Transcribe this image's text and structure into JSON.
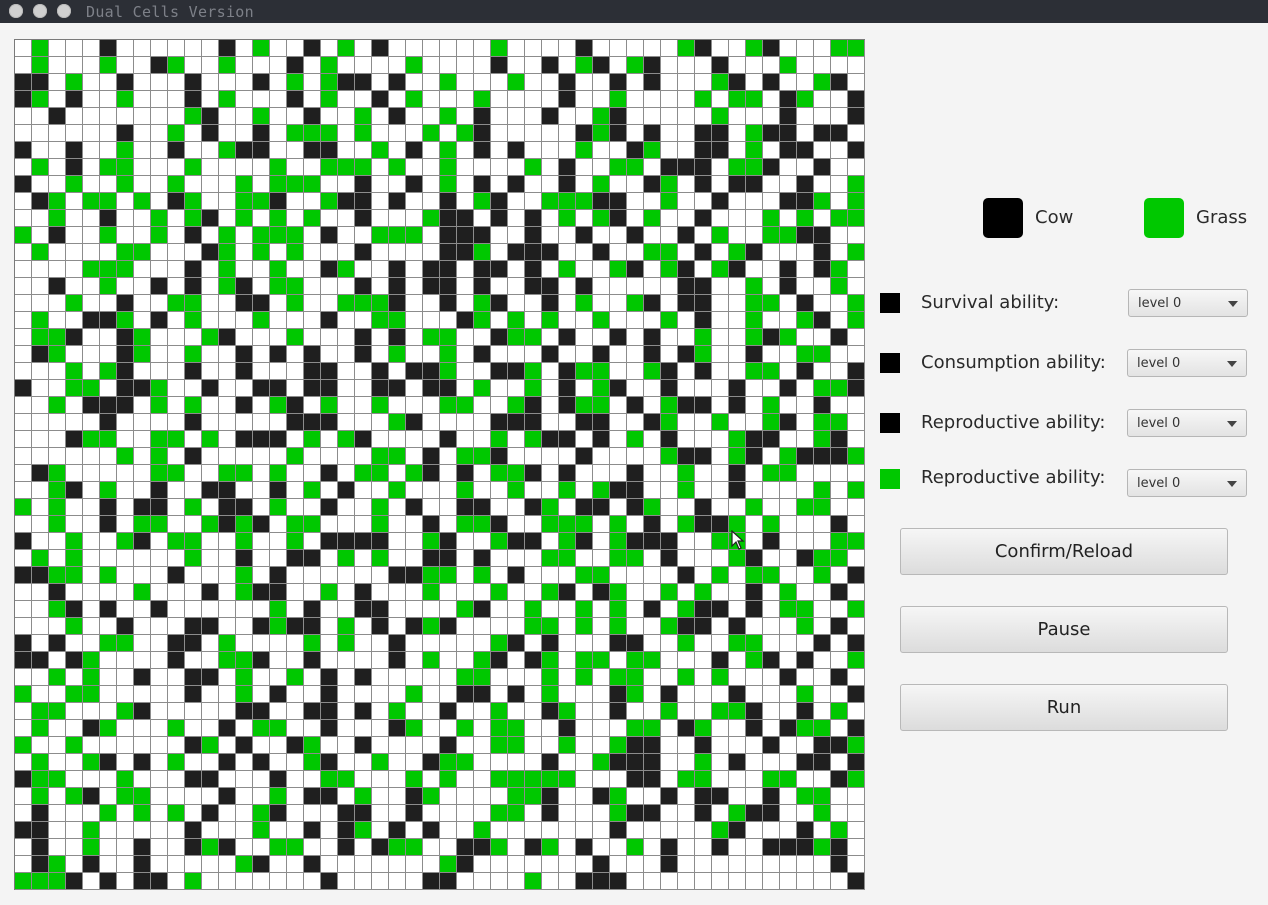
{
  "window": {
    "title": "Dual Cells Version"
  },
  "colors": {
    "cow": "#1f1f1f",
    "grass": "#00c800",
    "empty": "#ffffff",
    "grid_line": "#8c8c8c"
  },
  "legend": {
    "cow_label": "Cow",
    "grass_label": "Grass"
  },
  "controls": {
    "rows": [
      {
        "label": "Survival ability:",
        "swatch": "cow",
        "value": "level 0"
      },
      {
        "label": "Consumption ability:",
        "swatch": "cow",
        "value": "level 0"
      },
      {
        "label": "Reproductive ability:",
        "swatch": "cow",
        "value": "level 0"
      },
      {
        "label": "Reproductive ability:",
        "swatch": "grass",
        "value": "level 0"
      }
    ]
  },
  "buttons": {
    "confirm": "Confirm/Reload",
    "pause": "Pause",
    "run": "Run"
  },
  "grid": {
    "size": 50,
    "rows": [
      ".G...C......C.G..C.G.C......G....C.....GC..GC...GGG",
      ".G...G..CG..G...C.G....G....C..C.GC.GC...C...G....",
      "CC.G..C...C...C.G.GCC.C..G...G..C..C.C...GC.C..GC.",
      "CG.C..G...C.G...C.G..C.G...G....C..G....G.GG.CG..C",
      "..C.......GC..G..C..G.C..G.C...C..GC.....G...C...C",
      "......C..G.C..C.GGG.G...G.GC.....CGC.C..CC.GCC.CC.",
      "C..C..G..C..GCC..CC..G.C.G.C.C...G..CG..CC.G.CC..C",
      ".G.C.GG...G....G..GGG.G..G....G.C..GG.CCC.GGC..C..",
      "C..G..G..G...G.GGG..C..C.G.C.C..C.G..CG.C.CC..C..G",
      ".CG.GG.G.CG..GGC..GCC.C..C.GC..GGGCC..G..C...CCG.G",
      "..G..C..G.GC.G.G.G..C...GCC.C.C.G.GC.G..C...G.G.GG",
      "G.C..G..G.C.G.GGG.C..GGG.CCC..C..C..C..C.G..GGCC..",
      ".G....GG...CG.G.G...C....CCG.CCC..C..GG.C.GC...C.G",
      "....GGG...C.G..G..CG..C.CC.CC.C.G..GC.GC.GC..C.CG.",
      "..C..G..C.C.GC.GG...C.C.CC.C..CC.C.....CC..G.C..G.",
      "...G..C..GG..CC.G..GGGC..C.GC..C.G..GC.CC..GG.C..GG",
      ".G..CCG.C.G...G...C..GG...CG.G.G..G...G.C..G..GC.G",
      ".GGC..CG...GC...G...C.C.GG..CGG.C..C.C..G..GCG..C.",
      ".CG...CG..G..C.C.C..C.G..G.C...C..C..C.CG..C..GG..",
      "...G.GC...C..C...CC..C.CCG..CCG.CGG..GC.C..GG.C..C",
      "C..GG.CCG..C..CC.CC..CC.CC.G..G.C.GC..C...C..C.GGC",
      "..G.CCC.G.G..C.GC.G..G...GG..GC.CGG.C.GCC.C.G..C..",
      ".....C....C.....CCC...GC....CCC..CC..CG..G..GC.GG.",
      "...CGG..GG.G.CCC.G.GC....C..G.GCC.C.G.C...GCC..GC.",
      "......G.G.C.....G....GG.C.GGC....C....GCC.GC.GCCCG.",
      ".CG.....GG..GG.G..C.GG.GC.C.GGC.C...C..G..C.GG....G",
      "..GC.G..C..CC..C.G.C..G...G..G..G.GCC..G..C....G.G.",
      "G.G..C.CC.G.CC.G..C..G.C..CC..CG.CC.CG..C..G..GG..C",
      "..G..C.GG..GCGC.GG...G..C.GGC..GGG.G.C.GCCG.G...C.",
      "C..G..GC.GG..G..G.CCCC..GC..GCC.GC.GCCC..GG.C...GG",
      ".G.G......G..C..CC.G.G..CC.C...GG..GG.C...GC..CGG.",
      "CCGG.G...C...G.C......CCGG.G.C...GG....C.G.GG..G.C",
      "..C....G...C.GCC..G.C...G...G..GC.CG..G.G..C.G..C.",
      "..GC.C..C......G.C..CC....GC..G..G.G.C.GCC.C.GG..G",
      "...G..C...CC..CGCC.G.C.CGC....GG.G.G..GCC.C...G.C.",
      "C.C..GG..CC.G....G.G..C.....GC.C...CC..G..GG...C.C",
      "CC.CG....C..GGC..C....C.G..GC.CG.GG.GG...C.GC.C..G",
      "..G.G..C..CC.G..G.C.C.....GG...G.G.GG..G.G...C..C.",
      "G..GG.....C..G.C..C....G..CC.C.G...CG.C...C...G..C",
      ".GG...GC.....CC..CC.C.G..C..G..CG..C..G..GGC..C.G.",
      ".G..CG...G..C.GG..C...CG..G.GG..C...GG.CG..C.CGG.C",
      "G..G......CG.C..CG..C....C..GG..G..GCC..C...C..CCG",
      ".G..GC.C.G..C.C..GC..G..CGG....C..GCCC..G.C...CC.C",
      "CGG...G...CC...C..GG...G.G..GGGGG...CC.GG...GG..CG",
      ".G.GC.GG....C..G.CC.G..CG....GGC..CG..C.CC..C.GG.",
      ".C...G.G.G.C..GC...CC..C....GG.C...GCC..C.GCC..G..",
      "CC..G.....C...G..C.CG.C.C..G.......C.....GC...C.G.",
      ".C..G..C..CGC..GG..C.CGG..CCG.CG.C..G.C..C..CCCGC.",
      ".CG.C..C.....GC..C.......GC.......C...C.........C.",
      "GGGC.C.CC.G.......C.....CC....G..CCC.............C"
    ]
  }
}
